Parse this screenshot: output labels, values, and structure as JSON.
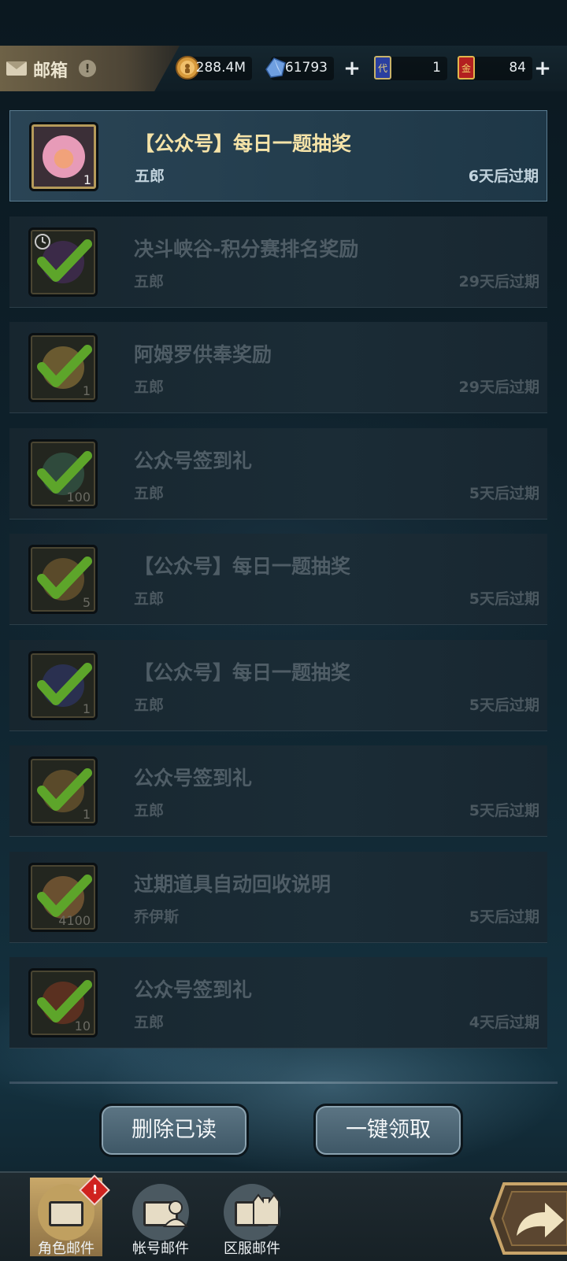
{
  "header": {
    "title": "邮箱",
    "info_icon": "info-icon",
    "resources": [
      {
        "name": "gold-coin-icon",
        "value": "288.4M"
      },
      {
        "name": "crystal-icon",
        "value": "61793"
      },
      {
        "name": "ticket-card-icon",
        "value": "1"
      },
      {
        "name": "gold-card-icon",
        "value": "84"
      }
    ]
  },
  "mails": [
    {
      "title": "【公众号】每日一题抽奖",
      "sender": "五郎",
      "expire": "6天后过期",
      "qty": "1",
      "read": false
    },
    {
      "title": "决斗峡谷-积分赛排名奖励",
      "sender": "五郎",
      "expire": "29天后过期",
      "qty": "",
      "read": true
    },
    {
      "title": "阿姆罗供奉奖励",
      "sender": "五郎",
      "expire": "29天后过期",
      "qty": "1",
      "read": true
    },
    {
      "title": "公众号签到礼",
      "sender": "五郎",
      "expire": "5天后过期",
      "qty": "100",
      "read": true
    },
    {
      "title": "【公众号】每日一题抽奖",
      "sender": "五郎",
      "expire": "5天后过期",
      "qty": "5",
      "read": true
    },
    {
      "title": "【公众号】每日一题抽奖",
      "sender": "五郎",
      "expire": "5天后过期",
      "qty": "1",
      "read": true
    },
    {
      "title": "公众号签到礼",
      "sender": "五郎",
      "expire": "5天后过期",
      "qty": "1",
      "read": true
    },
    {
      "title": "过期道具自动回收说明",
      "sender": "乔伊斯",
      "expire": "5天后过期",
      "qty": "4100",
      "read": true
    },
    {
      "title": "公众号签到礼",
      "sender": "五郎",
      "expire": "4天后过期",
      "qty": "10",
      "read": true
    }
  ],
  "actions": {
    "delete_read": "删除已读",
    "claim_all": "一键领取"
  },
  "tabs": [
    {
      "label": "角色邮件",
      "active": true,
      "badge": "!"
    },
    {
      "label": "帐号邮件",
      "active": false
    },
    {
      "label": "区服邮件",
      "active": false
    }
  ],
  "colors": {
    "active_title": "#f5e3a8",
    "check_green": "#5da52a",
    "badge_red": "#d0221f"
  }
}
